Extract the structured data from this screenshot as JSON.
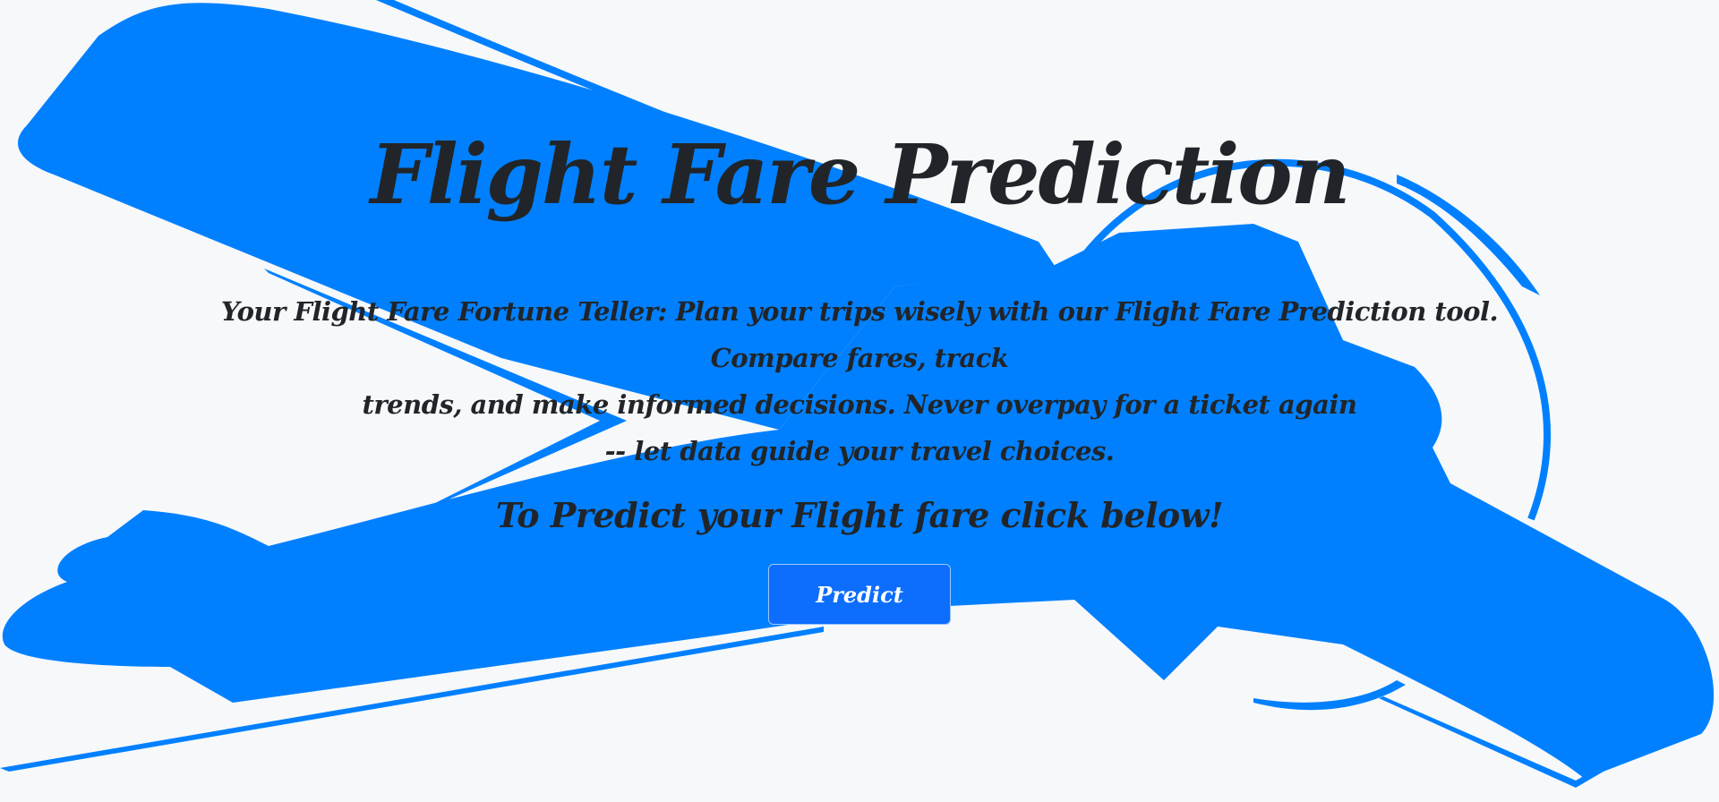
{
  "page": {
    "title": "Flight Fare Prediction",
    "tagline_line1": "Your Flight Fare Fortune Teller: Plan your trips wisely with our Flight Fare Prediction tool. Compare fares, track",
    "tagline_line2": "trends, and make informed decisions. Never overpay for a ticket again",
    "tagline_line3": "-- let data guide your travel choices.",
    "cta_text": "To Predict your Flight fare click below!",
    "predict_button_label": "Predict"
  },
  "background": {
    "icon": "airplane-silhouette",
    "color": "#0080ff",
    "page_color": "#f6f8fa"
  },
  "colors": {
    "text": "#212529",
    "button": "#0d6efd",
    "button_border": "#9ec5fe"
  }
}
